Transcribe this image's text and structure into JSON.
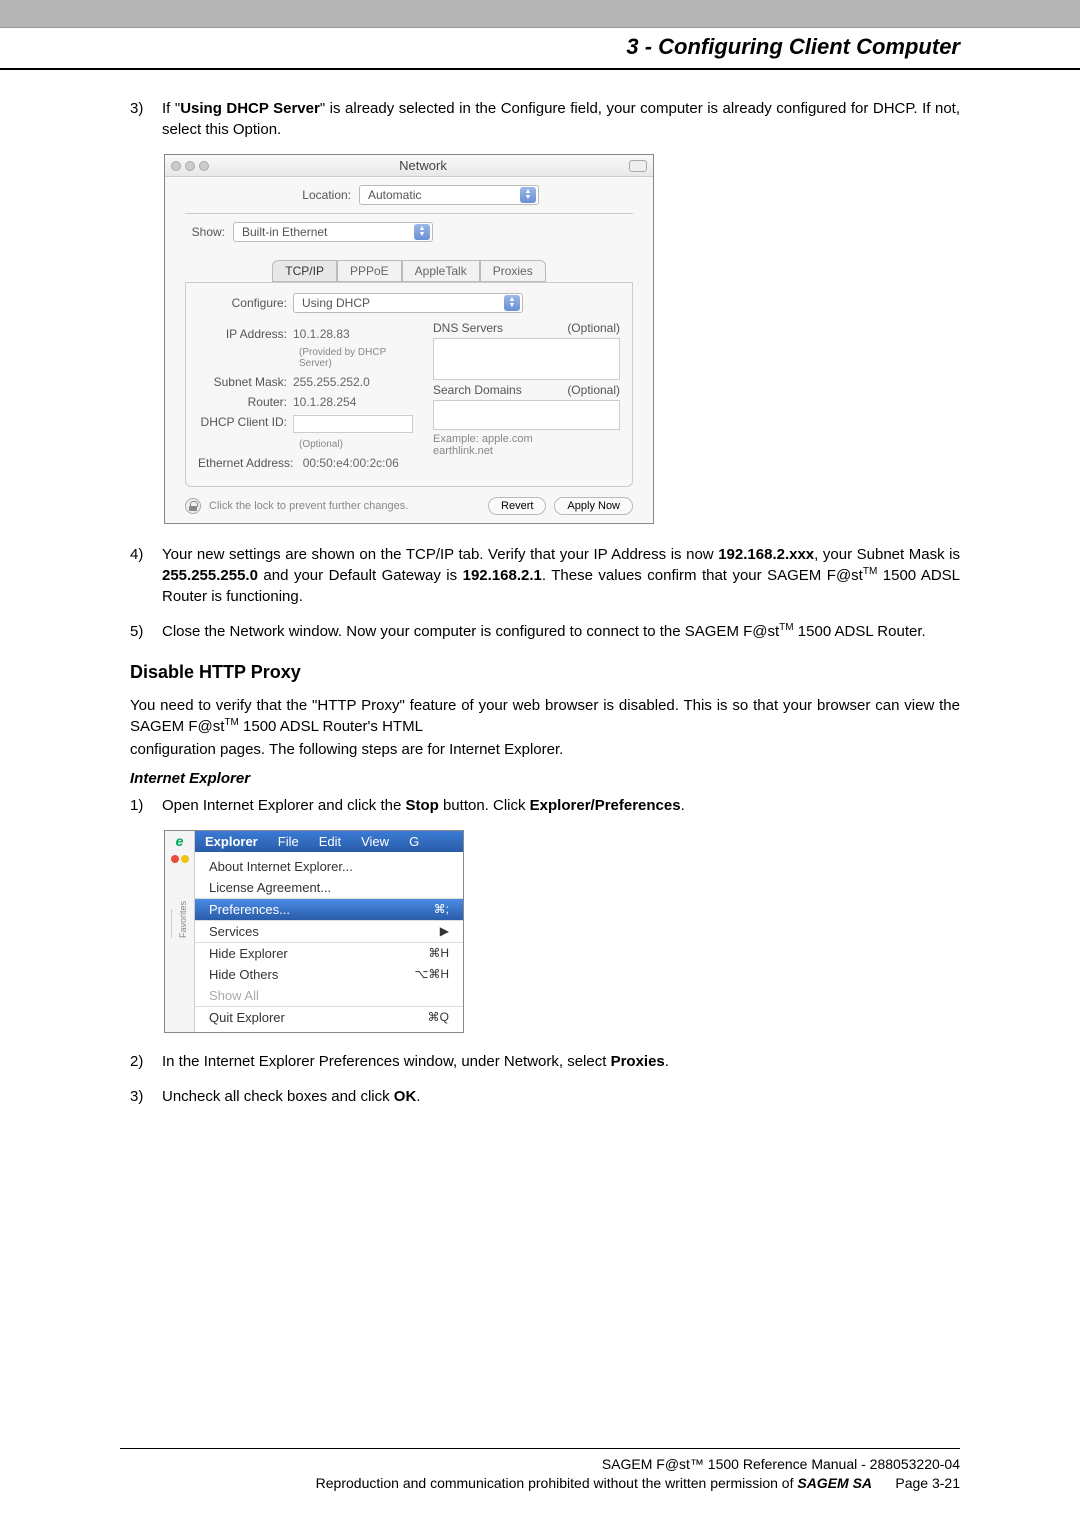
{
  "chapter_title": "3 - Configuring Client Computer",
  "step3": {
    "num": "3)",
    "text_pre": "If \"",
    "bold1": "Using DHCP Server",
    "text_mid": "\" is already selected in the Configure field, your computer is already configured for DHCP. If not, select this Option."
  },
  "network_window": {
    "title": "Network",
    "location_label": "Location:",
    "location_value": "Automatic",
    "show_label": "Show:",
    "show_value": "Built-in Ethernet",
    "tabs": [
      "TCP/IP",
      "PPPoE",
      "AppleTalk",
      "Proxies"
    ],
    "configure_label": "Configure:",
    "configure_value": "Using DHCP",
    "ip_label": "IP Address:",
    "ip_value": "10.1.28.83",
    "ip_sub": "(Provided by DHCP Server)",
    "subnet_label": "Subnet Mask:",
    "subnet_value": "255.255.252.0",
    "router_label": "Router:",
    "router_value": "10.1.28.254",
    "client_label": "DHCP Client ID:",
    "client_sub": "(Optional)",
    "dns_label": "DNS Servers",
    "dns_opt": "(Optional)",
    "search_label": "Search Domains",
    "search_opt": "(Optional)",
    "example_label": "Example:",
    "example_value": "apple.com\nearthlink.net",
    "eth_label": "Ethernet Address:",
    "eth_value": "00:50:e4:00:2c:06",
    "lock_text": "Click the lock to prevent further changes.",
    "btn_revert": "Revert",
    "btn_apply": "Apply Now"
  },
  "step4": {
    "num": "4)",
    "t1": "Your new settings are shown on the TCP/IP tab. Verify that your IP  Address is now ",
    "b1": "192.168.2.xxx",
    "t2": ", your Subnet Mask is ",
    "b2": "255.255.255.0",
    "t3": " and your Default Gateway is ",
    "b3": "192.168.2.1",
    "t4": ". These values confirm that your SAGEM F@st",
    "tm": "TM",
    "t5": " 1500 ADSL Router is functioning."
  },
  "step5": {
    "num": "5)",
    "t1": "Close the Network window. Now your computer is configured to connect to the SAGEM F@st",
    "tm": "TM",
    "t2": " 1500 ADSL Router."
  },
  "section2": "Disable HTTP Proxy",
  "para2a": "You need to verify that the \"HTTP Proxy\" feature of your web browser is disabled. This is so that your browser can view the SAGEM F@st",
  "para2a_tm": "TM",
  "para2b": " 1500 ADSL Router's HTML",
  "para2c": "configuration pages. The following steps are for Internet Explorer.",
  "subheading": "Internet Explorer",
  "ie_step1": {
    "num": "1)",
    "t1": "Open Internet Explorer and click the ",
    "b1": "Stop",
    "t2": " button. Click ",
    "b2": "Explorer/Preferences",
    "t3": "."
  },
  "explorer_menu": {
    "menubar": [
      "Explorer",
      "File",
      "Edit",
      "View",
      "G"
    ],
    "items": {
      "about": "About Internet Explorer...",
      "license": "License Agreement...",
      "prefs": "Preferences...",
      "prefs_short": "⌘;",
      "services": "Services",
      "services_arrow": "▶",
      "hide_exp": "Hide Explorer",
      "hide_exp_short": "⌘H",
      "hide_others": "Hide Others",
      "hide_others_short": "⌥⌘H",
      "show_all": "Show All",
      "quit": "Quit Explorer",
      "quit_short": "⌘Q"
    },
    "sidebar_favorites": "Favorites"
  },
  "ie_step2": {
    "num": "2)",
    "t1": "In the Internet Explorer Preferences window, under Network, select ",
    "b1": "Proxies",
    "t2": "."
  },
  "ie_step3": {
    "num": "3)",
    "t1": "Uncheck all check boxes and click ",
    "b1": "OK",
    "t2": "."
  },
  "footer": {
    "line1": "SAGEM F@st™ 1500 Reference Manual - 288053220-04",
    "line2a": "Reproduction and communication prohibited without the written permission of ",
    "line2b": "SAGEM SA",
    "page": "Page 3-21"
  }
}
